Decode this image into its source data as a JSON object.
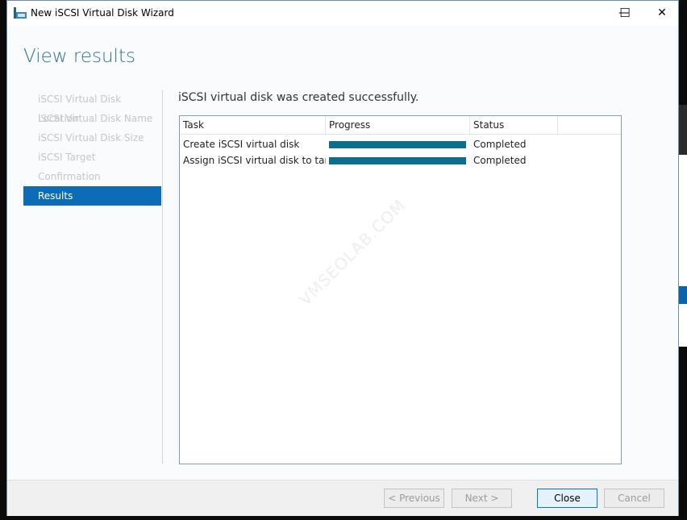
{
  "window": {
    "title": "New iSCSI Virtual Disk Wizard",
    "minimize": "—",
    "maximize": "☐",
    "close": "✕"
  },
  "heading": "View results",
  "nav": {
    "items": [
      {
        "label": "iSCSI Virtual Disk Location",
        "state": "disabled"
      },
      {
        "label": "iSCSI Virtual Disk Name",
        "state": "disabled"
      },
      {
        "label": "iSCSI Virtual Disk Size",
        "state": "disabled"
      },
      {
        "label": "iSCSI Target",
        "state": "disabled"
      },
      {
        "label": "Confirmation",
        "state": "disabled"
      },
      {
        "label": "Results",
        "state": "active"
      }
    ]
  },
  "message": "iSCSI virtual disk was created successfully.",
  "table": {
    "columns": [
      "Task",
      "Progress",
      "Status"
    ],
    "rows": [
      {
        "task": "Create iSCSI virtual disk",
        "progress": 100,
        "status": "Completed"
      },
      {
        "task": "Assign iSCSI virtual disk to target",
        "progress": 100,
        "status": "Completed"
      }
    ]
  },
  "watermark": "VMSEOLAB.COM",
  "buttons": {
    "previous": "< Previous",
    "next": "Next >",
    "close": "Close",
    "cancel": "Cancel"
  },
  "colors": {
    "accent": "#0d6cb7",
    "progress": "#0b6e8c",
    "heading": "#2a7496"
  }
}
